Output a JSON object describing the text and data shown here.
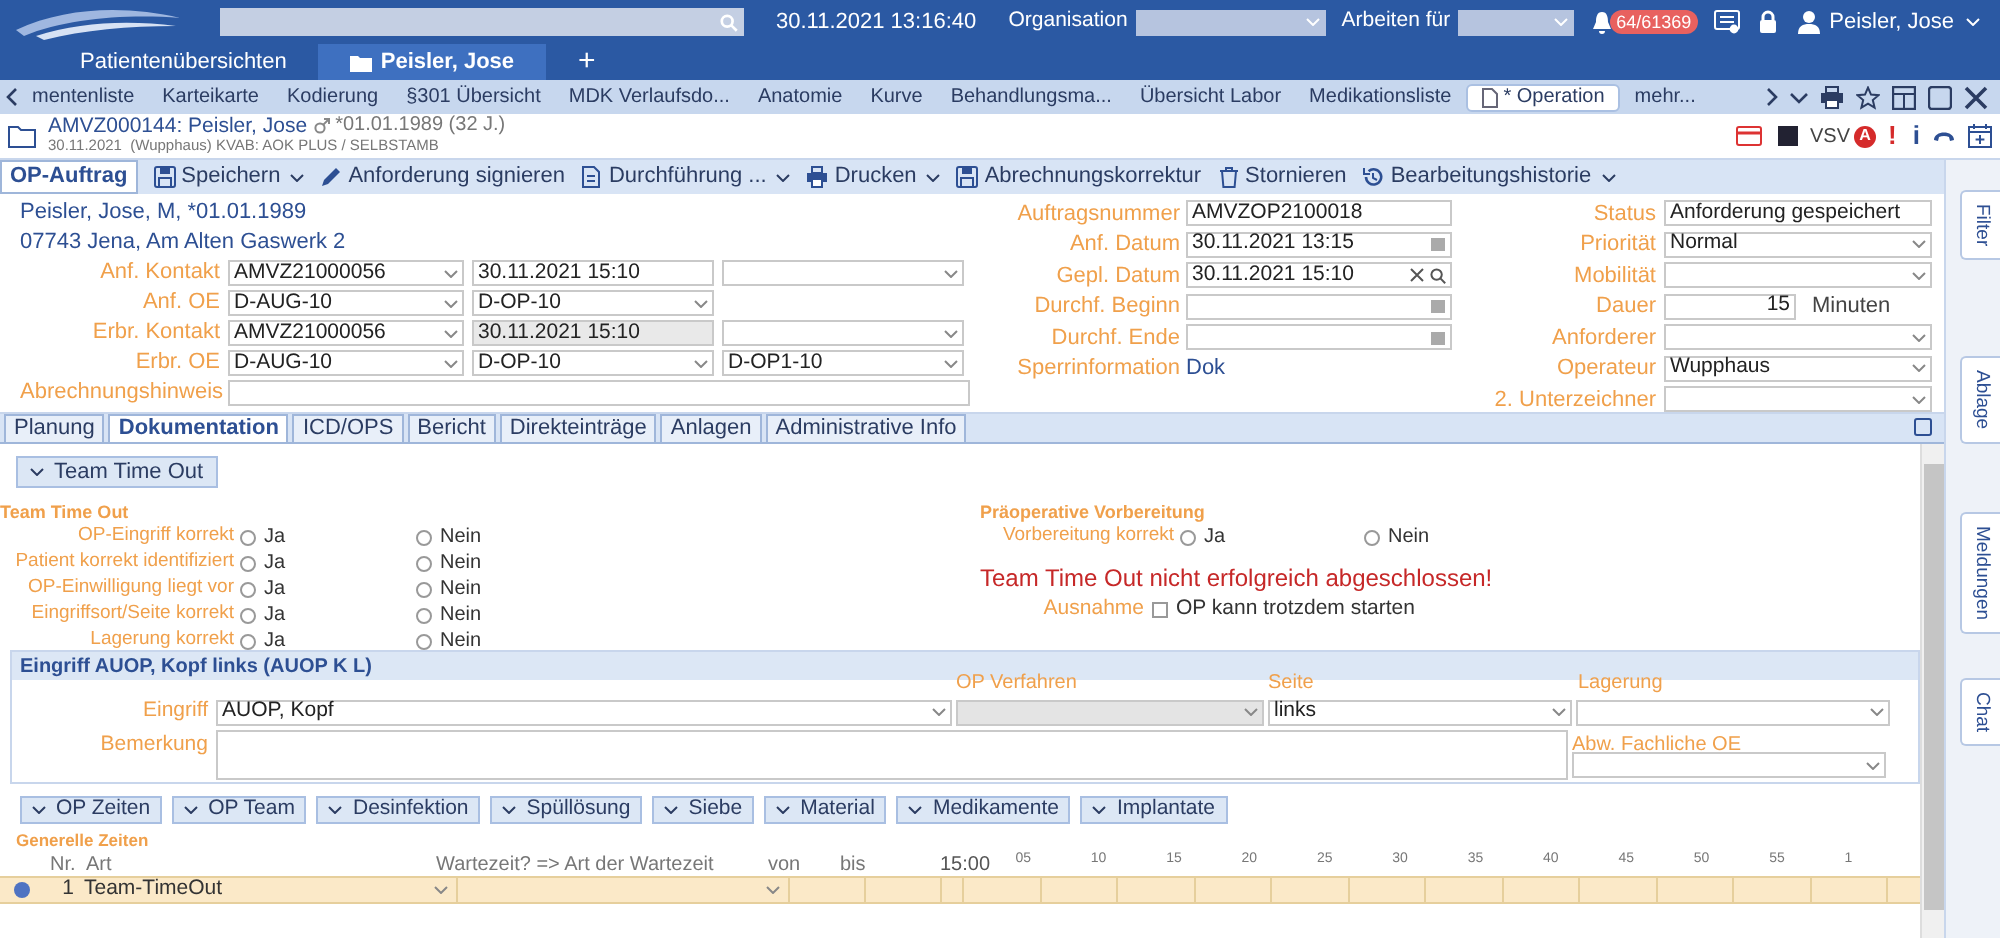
{
  "top_bar": {
    "datetime": "30.11.2021 13:16:40",
    "organisation_label": "Organisation",
    "work_for_label": "Arbeiten für",
    "notification_count": "64/61369",
    "user": "Peisler, Jose"
  },
  "patient_tabs": [
    {
      "label": "Patientenübersichten",
      "selected": false,
      "kind": "plain"
    },
    {
      "label": "Peisler, Jose",
      "selected": true,
      "kind": "folder"
    }
  ],
  "add_tab": "+",
  "nav_tabs": [
    {
      "label": "mentenliste",
      "selected": false
    },
    {
      "label": "Karteikarte",
      "selected": false
    },
    {
      "label": "Kodierung",
      "selected": false
    },
    {
      "label": "§301 Übersicht",
      "selected": false
    },
    {
      "label": "MDK Verlaufsdo...",
      "selected": false
    },
    {
      "label": "Anatomie",
      "selected": false
    },
    {
      "label": "Kurve",
      "selected": false
    },
    {
      "label": "Behandlungsma...",
      "selected": false
    },
    {
      "label": "Übersicht Labor",
      "selected": false
    },
    {
      "label": "Medikationsliste",
      "selected": false
    },
    {
      "label": "* Operation",
      "selected": true
    },
    {
      "label": "mehr...",
      "selected": false
    }
  ],
  "patient_header": {
    "title": "AMVZ000144: Peisler, Jose",
    "birth": "*01.01.1989 (32 J.)",
    "subline": "30.11.2021  (Wupphaus) KVAB: AOK PLUS / SELBSTAMB",
    "flag": "VSV",
    "alert_badge": "A",
    "warning_mark": "!",
    "info_mark": "i"
  },
  "toolbar": {
    "tab": "OP-Auftrag",
    "actions": [
      {
        "label": "Speichern",
        "dropdown": true
      },
      {
        "label": "Anforderung signieren",
        "dropdown": false
      },
      {
        "label": "Durchführung ...",
        "dropdown": true
      },
      {
        "label": "Drucken",
        "dropdown": true
      },
      {
        "label": "Abrechnungskorrektur",
        "dropdown": false
      },
      {
        "label": "Stornieren",
        "dropdown": false
      },
      {
        "label": "Bearbeitungshistorie",
        "dropdown": true
      }
    ]
  },
  "patient": {
    "name": "Peisler, Jose, M, *01.01.1989",
    "address": "07743 Jena, Am Alten Gaswerk 2"
  },
  "form_left": [
    {
      "label": "Anf. Kontakt",
      "fields": [
        {
          "kind": "select",
          "value": "AMVZ21000056"
        },
        {
          "kind": "text",
          "value": "30.11.2021 15:10"
        },
        {
          "kind": "select"
        }
      ]
    },
    {
      "label": "Anf. OE",
      "fields": [
        {
          "kind": "select",
          "value": "D-AUG-10"
        },
        {
          "kind": "select",
          "value": "D-OP-10"
        }
      ]
    },
    {
      "label": "Erbr. Kontakt",
      "fields": [
        {
          "kind": "select",
          "value": "AMVZ21000056"
        },
        {
          "kind": "readonly",
          "value": "30.11.2021 15:10"
        },
        {
          "kind": "select"
        }
      ]
    },
    {
      "label": "Erbr. OE",
      "fields": [
        {
          "kind": "select",
          "value": "D-AUG-10"
        },
        {
          "kind": "select",
          "value": "D-OP-10"
        },
        {
          "kind": "select",
          "value": "D-OP1-10"
        }
      ]
    },
    {
      "label": "Abrechnungshinweis",
      "fields": [
        {
          "kind": "wide"
        }
      ]
    }
  ],
  "form_middle": [
    {
      "label": "Auftragsnummer",
      "kind": "text",
      "value": "AMVZOP2100018"
    },
    {
      "label": "Anf. Datum",
      "kind": "date",
      "value": "30.11.2021 13:15"
    },
    {
      "label": "Gepl. Datum",
      "kind": "datesearch",
      "value": "30.11.2021 15:10"
    },
    {
      "label": "Durchf. Beginn",
      "kind": "date"
    },
    {
      "label": "Durchf. Ende",
      "kind": "date"
    },
    {
      "label": "Sperrinformation",
      "kind": "link",
      "value": "Dok"
    }
  ],
  "form_right": [
    {
      "label": "Status",
      "kind": "text",
      "value": "Anforderung gespeichert"
    },
    {
      "label": "Priorität",
      "kind": "select",
      "value": "Normal"
    },
    {
      "label": "Mobilität",
      "kind": "select"
    },
    {
      "label": "Dauer",
      "kind": "number",
      "value": "15",
      "unit": "Minuten"
    },
    {
      "label": "Anforderer",
      "kind": "select"
    },
    {
      "label": "Operateur",
      "kind": "select",
      "value": "Wupphaus"
    },
    {
      "label": "2. Unterzeichner",
      "kind": "select"
    }
  ],
  "subtabs": [
    {
      "label": "Planung",
      "selected": false
    },
    {
      "label": "Dokumentation",
      "selected": true
    },
    {
      "label": "ICD/OPS",
      "selected": false
    },
    {
      "label": "Bericht",
      "selected": false
    },
    {
      "label": "Direkteinträge",
      "selected": false
    },
    {
      "label": "Anlagen",
      "selected": false
    },
    {
      "label": "Administrative Info",
      "selected": false
    }
  ],
  "side_tabs": [
    "Filter",
    "Ablage",
    "Meldungen",
    "Chat"
  ],
  "team_time_out": {
    "button": "Team Time Out",
    "heading": "Team Time Out",
    "questions": [
      {
        "label": "OP-Eingriff korrekt",
        "options": [
          {
            "label": "Ja",
            "selected": false
          },
          {
            "label": "Nein",
            "selected": false
          }
        ]
      },
      {
        "label": "Patient korrekt identifiziert",
        "options": [
          {
            "label": "Ja",
            "selected": false
          },
          {
            "label": "Nein",
            "selected": false
          }
        ]
      },
      {
        "label": "OP-Einwilligung liegt vor",
        "options": [
          {
            "label": "Ja",
            "selected": false
          },
          {
            "label": "Nein",
            "selected": false
          }
        ]
      },
      {
        "label": "Eingriffsort/Seite korrekt",
        "options": [
          {
            "label": "Ja",
            "selected": false
          },
          {
            "label": "Nein",
            "selected": false
          }
        ]
      },
      {
        "label": "Lagerung korrekt",
        "options": [
          {
            "label": "Ja",
            "selected": false
          },
          {
            "label": "Nein",
            "selected": false
          }
        ]
      }
    ]
  },
  "preop": {
    "heading": "Präoperative Vorbereitung",
    "questions": [
      {
        "label": "Vorbereitung korrekt",
        "options": [
          {
            "label": "Ja",
            "selected": false
          },
          {
            "label": "Nein",
            "selected": false
          }
        ]
      }
    ],
    "error": "Team Time Out nicht erfolgreich abgeschlossen!",
    "exception_label": "Ausnahme",
    "exception_checkbox": {
      "label": "OP kann trotzdem starten",
      "checked": false
    }
  },
  "eingriff": {
    "title": "Eingriff AUOP, Kopf links (AUOP K L)",
    "eingriff_label": "Eingriff",
    "eingriff_value": "AUOP, Kopf",
    "verfahren_label": "OP Verfahren",
    "seite_label": "Seite",
    "seite_value": "links",
    "lagerung_label": "Lagerung",
    "bemerkung_label": "Bemerkung",
    "abw_label": "Abw. Fachliche OE"
  },
  "section_buttons": [
    "OP Zeiten",
    "OP Team",
    "Desinfektion",
    "Spüllösung",
    "Siebe",
    "Material",
    "Medikamente",
    "Implantate"
  ],
  "times": {
    "heading": "Generelle Zeiten",
    "columns": [
      "Nr.",
      "Art",
      "Wartezeit? => Art der Wartezeit",
      "von",
      "bis"
    ],
    "time_start": "15:00",
    "ticks": [
      "05",
      "10",
      "15",
      "20",
      "25",
      "30",
      "35",
      "40",
      "45",
      "50",
      "55",
      "1"
    ],
    "rows": [
      {
        "nr": "1",
        "art": "Team-TimeOut",
        "color": "#4f73c2"
      }
    ]
  }
}
